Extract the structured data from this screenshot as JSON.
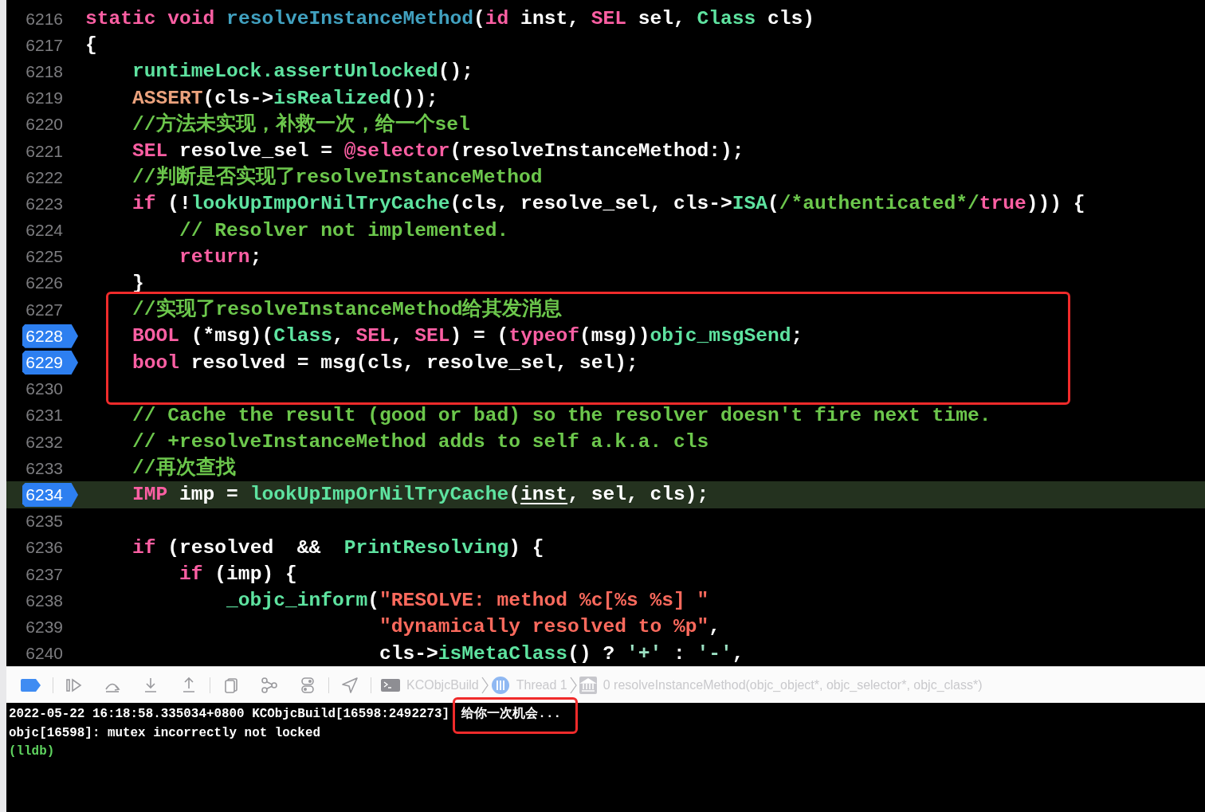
{
  "editor": {
    "lines": [
      {
        "number": "6216",
        "breakpoint": false,
        "current": false,
        "boxed": false,
        "tokens": [
          {
            "text": "static",
            "kind": "keyword"
          },
          {
            "text": " void",
            "kind": "keyword"
          },
          {
            "text": " resolveInstanceMethod",
            "kind": "declaration"
          },
          {
            "text": "(",
            "kind": "plain"
          },
          {
            "text": "id",
            "kind": "keyword"
          },
          {
            "text": " inst, ",
            "kind": "plain"
          },
          {
            "text": "SEL",
            "kind": "keyword"
          },
          {
            "text": " sel, ",
            "kind": "plain"
          },
          {
            "text": "Class",
            "kind": "function"
          },
          {
            "text": " cls)",
            "kind": "plain"
          }
        ]
      },
      {
        "number": "6217",
        "breakpoint": false,
        "current": false,
        "boxed": false,
        "tokens": [
          {
            "text": "{",
            "kind": "plain"
          }
        ]
      },
      {
        "number": "6218",
        "breakpoint": false,
        "current": false,
        "boxed": false,
        "tokens": [
          {
            "text": "    runtimeLock.assertUnlocked",
            "kind": "function"
          },
          {
            "text": "();",
            "kind": "plain"
          }
        ]
      },
      {
        "number": "6219",
        "breakpoint": false,
        "current": false,
        "boxed": false,
        "tokens": [
          {
            "text": "    ASSERT",
            "kind": "macro"
          },
          {
            "text": "(cls->",
            "kind": "plain"
          },
          {
            "text": "isRealized",
            "kind": "function"
          },
          {
            "text": "());",
            "kind": "plain"
          }
        ]
      },
      {
        "number": "6220",
        "breakpoint": false,
        "current": false,
        "boxed": false,
        "tokens": [
          {
            "text": "    //方法未实现，补救一次，给一个sel",
            "kind": "comment"
          }
        ]
      },
      {
        "number": "6221",
        "breakpoint": false,
        "current": false,
        "boxed": false,
        "tokens": [
          {
            "text": "    SEL",
            "kind": "keyword"
          },
          {
            "text": " resolve_sel = ",
            "kind": "plain"
          },
          {
            "text": "@selector",
            "kind": "keyword"
          },
          {
            "text": "(resolveInstanceMethod:);",
            "kind": "plain"
          }
        ]
      },
      {
        "number": "6222",
        "breakpoint": false,
        "current": false,
        "boxed": false,
        "tokens": [
          {
            "text": "    //判断是否实现了resolveInstanceMethod",
            "kind": "comment"
          }
        ]
      },
      {
        "number": "6223",
        "breakpoint": false,
        "current": false,
        "boxed": false,
        "tokens": [
          {
            "text": "    if",
            "kind": "keyword"
          },
          {
            "text": " (!",
            "kind": "plain"
          },
          {
            "text": "lookUpImpOrNilTryCache",
            "kind": "function"
          },
          {
            "text": "(cls, resolve_sel, cls->",
            "kind": "plain"
          },
          {
            "text": "ISA",
            "kind": "function"
          },
          {
            "text": "(",
            "kind": "plain"
          },
          {
            "text": "/*authenticated*/",
            "kind": "comment"
          },
          {
            "text": "true",
            "kind": "keyword"
          },
          {
            "text": "))) {",
            "kind": "plain"
          }
        ]
      },
      {
        "number": "6224",
        "breakpoint": false,
        "current": false,
        "boxed": false,
        "tokens": [
          {
            "text": "        // Resolver not implemented.",
            "kind": "comment"
          }
        ]
      },
      {
        "number": "6225",
        "breakpoint": false,
        "current": false,
        "boxed": false,
        "tokens": [
          {
            "text": "        return",
            "kind": "keyword"
          },
          {
            "text": ";",
            "kind": "plain"
          }
        ]
      },
      {
        "number": "6226",
        "breakpoint": false,
        "current": false,
        "boxed": false,
        "tokens": [
          {
            "text": "    }",
            "kind": "plain"
          }
        ]
      },
      {
        "number": "6227",
        "breakpoint": false,
        "current": false,
        "boxed": true,
        "tokens": [
          {
            "text": "    //实现了resolveInstanceMethod给其发消息",
            "kind": "comment"
          }
        ]
      },
      {
        "number": "6228",
        "breakpoint": true,
        "current": false,
        "boxed": true,
        "tokens": [
          {
            "text": "    BOOL",
            "kind": "keyword"
          },
          {
            "text": " (*msg)(",
            "kind": "plain"
          },
          {
            "text": "Class",
            "kind": "function"
          },
          {
            "text": ", ",
            "kind": "plain"
          },
          {
            "text": "SEL",
            "kind": "keyword"
          },
          {
            "text": ", ",
            "kind": "plain"
          },
          {
            "text": "SEL",
            "kind": "keyword"
          },
          {
            "text": ") = (",
            "kind": "plain"
          },
          {
            "text": "typeof",
            "kind": "keyword"
          },
          {
            "text": "(msg))",
            "kind": "plain"
          },
          {
            "text": "objc_msgSend",
            "kind": "function"
          },
          {
            "text": ";",
            "kind": "plain"
          }
        ]
      },
      {
        "number": "6229",
        "breakpoint": true,
        "current": false,
        "boxed": true,
        "tokens": [
          {
            "text": "    bool",
            "kind": "keyword"
          },
          {
            "text": " resolved = msg(cls, resolve_sel, sel);",
            "kind": "plain"
          }
        ]
      },
      {
        "number": "6230",
        "breakpoint": false,
        "current": false,
        "boxed": true
      },
      {
        "number": "6231",
        "breakpoint": false,
        "current": false,
        "boxed": false,
        "tokens": [
          {
            "text": "    // Cache the result (good or bad) so the resolver doesn't fire next time.",
            "kind": "comment"
          }
        ]
      },
      {
        "number": "6232",
        "breakpoint": false,
        "current": false,
        "boxed": false,
        "tokens": [
          {
            "text": "    // +resolveInstanceMethod adds to self a.k.a. cls",
            "kind": "comment"
          }
        ]
      },
      {
        "number": "6233",
        "breakpoint": false,
        "current": false,
        "boxed": false,
        "tokens": [
          {
            "text": "    //再次查找",
            "kind": "comment"
          }
        ]
      },
      {
        "number": "6234",
        "breakpoint": true,
        "current": true,
        "boxed": false,
        "tokens": [
          {
            "text": "    IMP",
            "kind": "keyword"
          },
          {
            "text": " imp = ",
            "kind": "plain"
          },
          {
            "text": "lookUpImpOrNilTryCache",
            "kind": "function"
          },
          {
            "text": "(",
            "kind": "plain"
          },
          {
            "text": "inst",
            "kind": "parameter"
          },
          {
            "text": ", sel, cls);",
            "kind": "plain"
          }
        ]
      },
      {
        "number": "6235",
        "breakpoint": false,
        "current": false,
        "boxed": false
      },
      {
        "number": "6236",
        "breakpoint": false,
        "current": false,
        "boxed": false,
        "tokens": [
          {
            "text": "    if",
            "kind": "keyword"
          },
          {
            "text": " (resolved  &&  ",
            "kind": "plain"
          },
          {
            "text": "PrintResolving",
            "kind": "function"
          },
          {
            "text": ") {",
            "kind": "plain"
          }
        ]
      },
      {
        "number": "6237",
        "breakpoint": false,
        "current": false,
        "boxed": false,
        "tokens": [
          {
            "text": "        if",
            "kind": "keyword"
          },
          {
            "text": " (imp) {",
            "kind": "plain"
          }
        ]
      },
      {
        "number": "6238",
        "breakpoint": false,
        "current": false,
        "boxed": false,
        "tokens": [
          {
            "text": "            _objc_inform",
            "kind": "function"
          },
          {
            "text": "(",
            "kind": "plain"
          },
          {
            "text": "\"RESOLVE: method %c[%s %s] \"",
            "kind": "string"
          }
        ]
      },
      {
        "number": "6239",
        "breakpoint": false,
        "current": false,
        "boxed": false,
        "tokens": [
          {
            "text": "                         \"dynamically resolved to %p\"",
            "kind": "string"
          },
          {
            "text": ",",
            "kind": "plain"
          }
        ]
      },
      {
        "number": "6240",
        "breakpoint": false,
        "current": false,
        "boxed": false,
        "tokens": [
          {
            "text": "                         cls->",
            "kind": "plain"
          },
          {
            "text": "isMetaClass",
            "kind": "function"
          },
          {
            "text": "() ? ",
            "kind": "plain"
          },
          {
            "text": "'+'",
            "kind": "character"
          },
          {
            "text": " : ",
            "kind": "plain"
          },
          {
            "text": "'-'",
            "kind": "character"
          },
          {
            "text": ",",
            "kind": "plain"
          }
        ]
      }
    ]
  },
  "debug_bar": {
    "breakpoints_active": true,
    "breadcrumb": [
      "KCObjcBuild",
      "Thread 1",
      "0 resolveInstanceMethod(objc_object*, objc_selector*, objc_class*)"
    ]
  },
  "console": {
    "lines": [
      {
        "kind": "output",
        "segments": [
          {
            "text": "2022-05-22 16:18:58.335034+0800 KCObjcBuild[16598:2492273]",
            "boxed": false
          },
          {
            "text": "给你一次机会...",
            "boxed": true
          }
        ]
      },
      {
        "kind": "output",
        "segments": [
          {
            "text": "objc[16598]: mutex incorrectly not locked",
            "boxed": false
          }
        ]
      },
      {
        "kind": "prompt",
        "segments": [
          {
            "text": "(lldb)",
            "boxed": false
          }
        ]
      }
    ]
  }
}
